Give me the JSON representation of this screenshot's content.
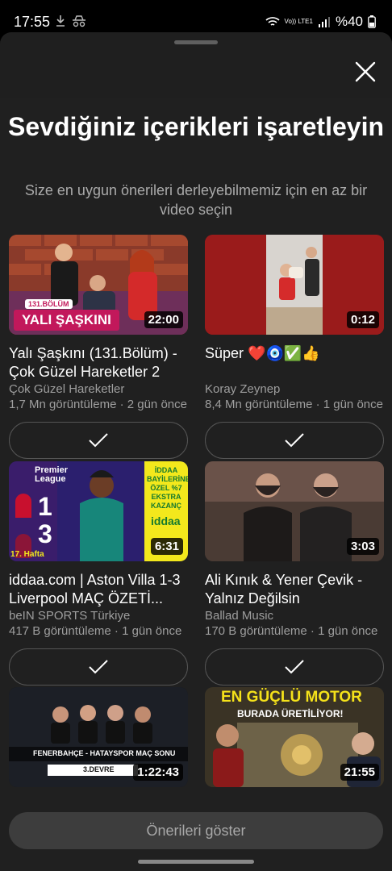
{
  "status": {
    "time": "17:55",
    "network": "Vo)) LTE1",
    "battery": "%40"
  },
  "header": {
    "title": "Sevdiğiniz içerikleri işaretleyin",
    "subtitle": "Size en uygun önerileri derleyebilmemiz için en az bir video seçin"
  },
  "videos": [
    {
      "title": "Yalı Şaşkını (131.Bölüm) - Çok Güzel Hareketler 2",
      "channel": "Çok Güzel Hareketler",
      "meta": "1,7 Mn görüntüleme · 2 gün önce",
      "duration": "22:00",
      "thumb_text": "YALI ŞAŞKINI",
      "thumb_badge": "131.BÖLÜM"
    },
    {
      "title": "Süper ❤️🧿✅👍",
      "channel": "Koray Zeynep",
      "meta": "8,4 Mn görüntüleme · 1 gün önce",
      "duration": "0:12"
    },
    {
      "title": "iddaa.com | Aston Villa 1-3 Liverpool MAÇ ÖZETİ...",
      "channel": "beIN SPORTS Türkiye",
      "meta": "417 B görüntüleme · 1 gün önce",
      "duration": "6:31",
      "thumb_league": "Premier League",
      "thumb_score_home": "1",
      "thumb_score_away": "3",
      "thumb_week": "17. Hafta",
      "thumb_promo": "İDDAA BAYİLERİNE ÖZEL %7 EKSTRA KAZANÇ",
      "thumb_brand": "iddaa"
    },
    {
      "title": "Ali Kınık & Yener Çevik - Yalnız Değilsin",
      "channel": "Ballad Music",
      "meta": "170 B görüntüleme · 1 gün önce",
      "duration": "3:03"
    },
    {
      "title": "",
      "channel": "",
      "meta": "",
      "duration": "1:22:43",
      "thumb_text": "FENERBAHÇE - HATAYSPOR MAÇ SONU",
      "thumb_badge": "3.DEVRE"
    },
    {
      "title": "",
      "channel": "",
      "meta": "",
      "duration": "21:55",
      "thumb_text": "EN GÜÇLÜ MOTOR",
      "thumb_badge": "BURADA ÜRETİLİYOR!"
    }
  ],
  "footer": {
    "button_label": "Önerileri göster"
  },
  "colors": {
    "background": "#0f0f0f",
    "sheet": "#202020",
    "button": "#3d3d3d"
  }
}
